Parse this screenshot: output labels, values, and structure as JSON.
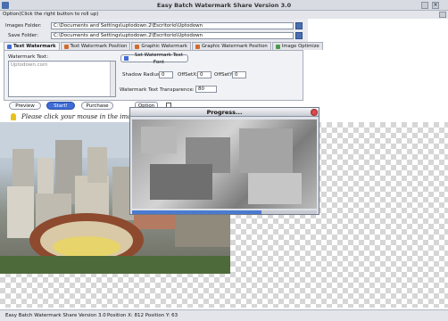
{
  "window": {
    "title": "Easy Batch Watermark Share Version 3.0"
  },
  "option_bar": {
    "label": "Option(Click the right button to roll up)"
  },
  "folders": {
    "images_label": "Images Folder:",
    "images_value": "C:\\Documents and Settings\\uptodown.2\\Escritorio\\Uptodown",
    "save_label": "Save Folder:",
    "save_value": "C:\\Documents and Settings\\uptodown.2\\Escritorio\\Uptodown"
  },
  "tabs": [
    {
      "label": "Text Watermark"
    },
    {
      "label": "Text Watermark Position"
    },
    {
      "label": "Graphic Watermark"
    },
    {
      "label": "Graphic Watermark Position"
    },
    {
      "label": "Image Optimize"
    }
  ],
  "text_watermark": {
    "label": "Watermark Text:",
    "value": "Uptodown.com",
    "font_button": "Set Watermark Text Font",
    "shadow_radius_label": "Shadow Radius:",
    "shadow_radius": "0",
    "offset_x_label": "OffSetX:",
    "offset_x": "0",
    "offset_y_label": "OffSetY:",
    "offset_y": "0",
    "transparence_label": "Watermark Text Transparence:",
    "transparence": "80"
  },
  "actions": {
    "preview": "Preview",
    "start": "Start!",
    "purchase": "Purchase"
  },
  "hint": {
    "text": "Please click your mouse in the image a"
  },
  "progress_dialog": {
    "title": "Progress...",
    "progress": 0.7
  },
  "status": {
    "app": "Easy Batch Watermark Share Version 3.0",
    "position": "Position X: 812  Position Y: 63"
  },
  "colors": {
    "accent": "#3f6bd6",
    "progress_fill": "#4a7bd0"
  }
}
